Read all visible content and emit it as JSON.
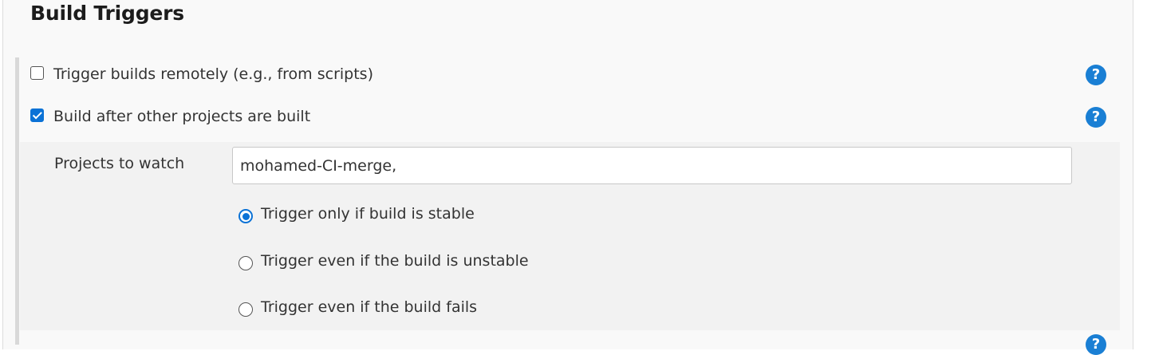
{
  "section": {
    "title": "Build Triggers"
  },
  "triggers": {
    "remote": {
      "label": "Trigger builds remotely (e.g., from scripts)",
      "checked": false
    },
    "after_other": {
      "label": "Build after other projects are built",
      "checked": true,
      "projects_label": "Projects to watch",
      "projects_value": "mohamed-CI-merge,",
      "options": [
        {
          "label": "Trigger only if build is stable",
          "selected": true
        },
        {
          "label": "Trigger even if the build is unstable",
          "selected": false
        },
        {
          "label": "Trigger even if the build fails",
          "selected": false
        }
      ]
    }
  },
  "help": {
    "icon_glyph": "?",
    "icon_name": "help-icon"
  },
  "colors": {
    "accent": "#0b72d6",
    "help": "#1a7fd4"
  }
}
